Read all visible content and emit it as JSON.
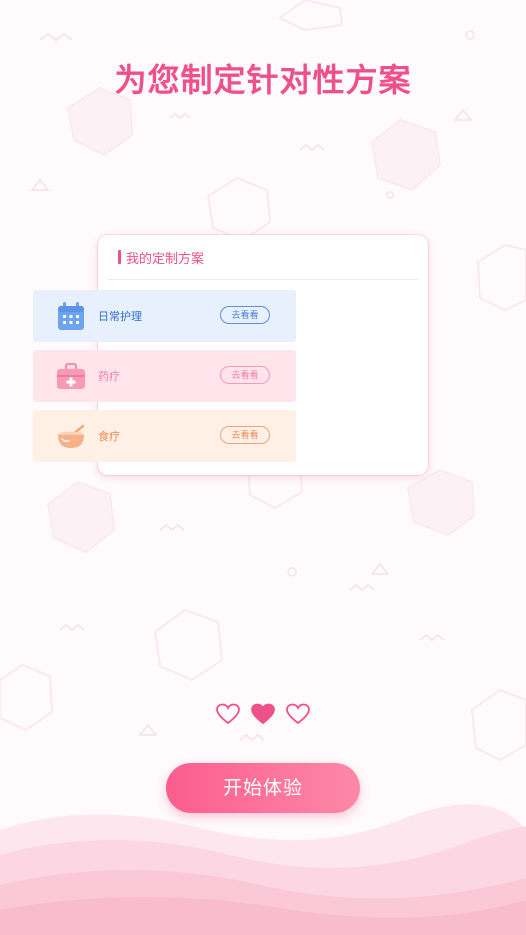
{
  "headline": "为您制定针对性方案",
  "card": {
    "title": "我的定制方案",
    "items": [
      {
        "label": "日常护理",
        "button": "去看看",
        "icon": "calendar-icon"
      },
      {
        "label": "药疗",
        "button": "去看看",
        "icon": "medical-kit-icon"
      },
      {
        "label": "食疗",
        "button": "去看看",
        "icon": "bowl-icon"
      }
    ]
  },
  "pager": {
    "total": 3,
    "active_index": 1
  },
  "start_button": "开始体验",
  "colors": {
    "accent_pink": "#f0508a",
    "care_blue": "#2e6fd2",
    "medicine_pink": "#f47ea2",
    "food_orange": "#f2884c",
    "wave_pink": "#fbc8d7"
  }
}
